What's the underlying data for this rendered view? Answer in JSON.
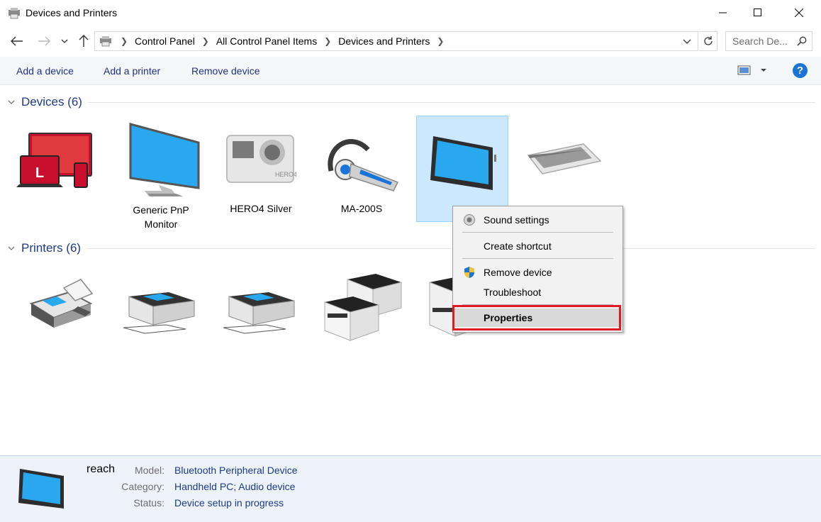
{
  "window": {
    "title": "Devices and Printers",
    "icon": "devices-printers-icon"
  },
  "navigation": {
    "breadcrumbs": [
      "Control Panel",
      "All Control Panel Items",
      "Devices and Printers"
    ],
    "search_placeholder": "Search De..."
  },
  "toolbar": {
    "add_device": "Add a device",
    "add_printer": "Add a printer",
    "remove_device": "Remove device",
    "help": "?"
  },
  "devices_group": {
    "label": "Devices (6)",
    "items": [
      {
        "label": "",
        "icon": "computer-icon"
      },
      {
        "label": "Generic PnP Monitor",
        "icon": "monitor-icon"
      },
      {
        "label": "HERO4 Silver",
        "icon": "camera-icon"
      },
      {
        "label": "MA-200S",
        "icon": "headset-icon"
      },
      {
        "label": "r",
        "icon": "tablet-icon"
      },
      {
        "label": "",
        "icon": "keyboard-icon"
      }
    ]
  },
  "printers_group": {
    "label": "Printers (6)",
    "items": [
      {
        "label": "",
        "icon": "fax-icon"
      },
      {
        "label": "",
        "icon": "printer-icon"
      },
      {
        "label": "",
        "icon": "printer-icon"
      },
      {
        "label": "",
        "icon": "mfp-printer-icon"
      },
      {
        "label": "",
        "icon": "mfp-printer-icon"
      }
    ]
  },
  "context_menu": {
    "items": [
      {
        "label": "Sound settings",
        "icon": "speaker-icon"
      },
      {
        "label": "Create shortcut"
      },
      {
        "label": "Remove device",
        "icon": "uac-shield-icon"
      },
      {
        "label": "Troubleshoot"
      },
      {
        "label": "Properties",
        "highlighted": true
      }
    ]
  },
  "details": {
    "name": "reach",
    "model_label": "Model:",
    "model_value": "Bluetooth Peripheral Device",
    "category_label": "Category:",
    "category_value": "Handheld PC; Audio device",
    "status_label": "Status:",
    "status_value": "Device setup in progress"
  },
  "colors": {
    "accent": "#1e3a8a",
    "selection": "#cce8ff",
    "highlight_border": "#e01b24"
  }
}
